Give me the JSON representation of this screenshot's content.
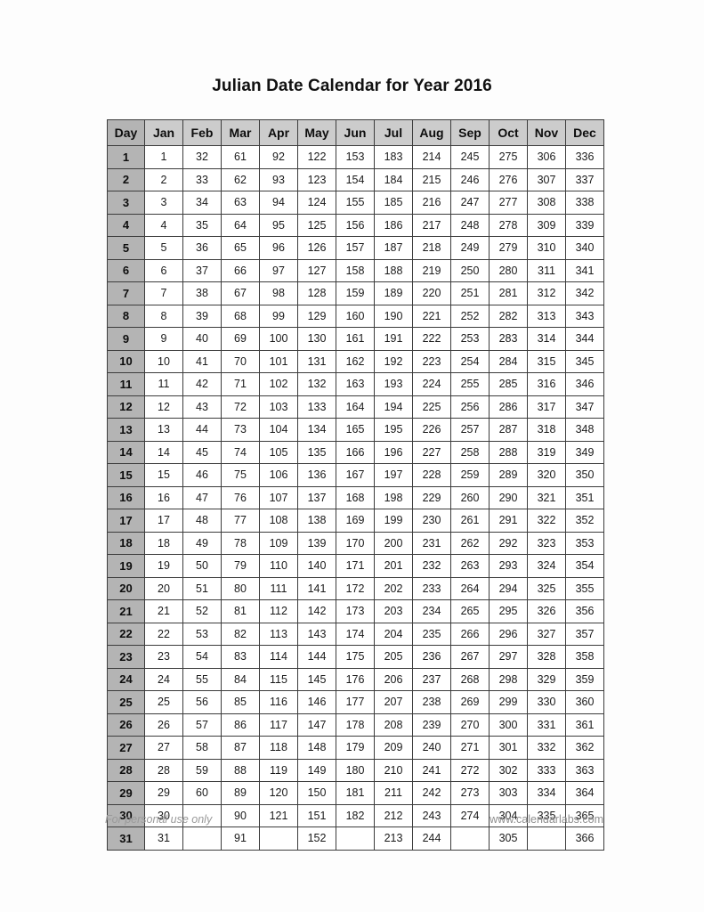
{
  "page": {
    "title": "Julian Date Calendar for Year 2016",
    "year": "2016"
  },
  "footer": {
    "left": "For personal use only",
    "right": "www.calendarlabs.com"
  },
  "colors": {
    "header_gray": "#cccccc",
    "day_column_gray": "#b4b4b4",
    "grid_line": "#3c3c3c",
    "cell_background": "#ffffff",
    "footer_text": "#9a9a9a",
    "title_text": "#111111"
  },
  "chart_data": {
    "type": "table",
    "title": "Julian Date Calendar for Year 2016",
    "columns": [
      "Day",
      "Jan",
      "Feb",
      "Mar",
      "Apr",
      "May",
      "Jun",
      "Jul",
      "Aug",
      "Sep",
      "Oct",
      "Nov",
      "Dec"
    ],
    "rows": [
      [
        "1",
        "1",
        "32",
        "61",
        "92",
        "122",
        "153",
        "183",
        "214",
        "245",
        "275",
        "306",
        "336"
      ],
      [
        "2",
        "2",
        "33",
        "62",
        "93",
        "123",
        "154",
        "184",
        "215",
        "246",
        "276",
        "307",
        "337"
      ],
      [
        "3",
        "3",
        "34",
        "63",
        "94",
        "124",
        "155",
        "185",
        "216",
        "247",
        "277",
        "308",
        "338"
      ],
      [
        "4",
        "4",
        "35",
        "64",
        "95",
        "125",
        "156",
        "186",
        "217",
        "248",
        "278",
        "309",
        "339"
      ],
      [
        "5",
        "5",
        "36",
        "65",
        "96",
        "126",
        "157",
        "187",
        "218",
        "249",
        "279",
        "310",
        "340"
      ],
      [
        "6",
        "6",
        "37",
        "66",
        "97",
        "127",
        "158",
        "188",
        "219",
        "250",
        "280",
        "311",
        "341"
      ],
      [
        "7",
        "7",
        "38",
        "67",
        "98",
        "128",
        "159",
        "189",
        "220",
        "251",
        "281",
        "312",
        "342"
      ],
      [
        "8",
        "8",
        "39",
        "68",
        "99",
        "129",
        "160",
        "190",
        "221",
        "252",
        "282",
        "313",
        "343"
      ],
      [
        "9",
        "9",
        "40",
        "69",
        "100",
        "130",
        "161",
        "191",
        "222",
        "253",
        "283",
        "314",
        "344"
      ],
      [
        "10",
        "10",
        "41",
        "70",
        "101",
        "131",
        "162",
        "192",
        "223",
        "254",
        "284",
        "315",
        "345"
      ],
      [
        "11",
        "11",
        "42",
        "71",
        "102",
        "132",
        "163",
        "193",
        "224",
        "255",
        "285",
        "316",
        "346"
      ],
      [
        "12",
        "12",
        "43",
        "72",
        "103",
        "133",
        "164",
        "194",
        "225",
        "256",
        "286",
        "317",
        "347"
      ],
      [
        "13",
        "13",
        "44",
        "73",
        "104",
        "134",
        "165",
        "195",
        "226",
        "257",
        "287",
        "318",
        "348"
      ],
      [
        "14",
        "14",
        "45",
        "74",
        "105",
        "135",
        "166",
        "196",
        "227",
        "258",
        "288",
        "319",
        "349"
      ],
      [
        "15",
        "15",
        "46",
        "75",
        "106",
        "136",
        "167",
        "197",
        "228",
        "259",
        "289",
        "320",
        "350"
      ],
      [
        "16",
        "16",
        "47",
        "76",
        "107",
        "137",
        "168",
        "198",
        "229",
        "260",
        "290",
        "321",
        "351"
      ],
      [
        "17",
        "17",
        "48",
        "77",
        "108",
        "138",
        "169",
        "199",
        "230",
        "261",
        "291",
        "322",
        "352"
      ],
      [
        "18",
        "18",
        "49",
        "78",
        "109",
        "139",
        "170",
        "200",
        "231",
        "262",
        "292",
        "323",
        "353"
      ],
      [
        "19",
        "19",
        "50",
        "79",
        "110",
        "140",
        "171",
        "201",
        "232",
        "263",
        "293",
        "324",
        "354"
      ],
      [
        "20",
        "20",
        "51",
        "80",
        "111",
        "141",
        "172",
        "202",
        "233",
        "264",
        "294",
        "325",
        "355"
      ],
      [
        "21",
        "21",
        "52",
        "81",
        "112",
        "142",
        "173",
        "203",
        "234",
        "265",
        "295",
        "326",
        "356"
      ],
      [
        "22",
        "22",
        "53",
        "82",
        "113",
        "143",
        "174",
        "204",
        "235",
        "266",
        "296",
        "327",
        "357"
      ],
      [
        "23",
        "23",
        "54",
        "83",
        "114",
        "144",
        "175",
        "205",
        "236",
        "267",
        "297",
        "328",
        "358"
      ],
      [
        "24",
        "24",
        "55",
        "84",
        "115",
        "145",
        "176",
        "206",
        "237",
        "268",
        "298",
        "329",
        "359"
      ],
      [
        "25",
        "25",
        "56",
        "85",
        "116",
        "146",
        "177",
        "207",
        "238",
        "269",
        "299",
        "330",
        "360"
      ],
      [
        "26",
        "26",
        "57",
        "86",
        "117",
        "147",
        "178",
        "208",
        "239",
        "270",
        "300",
        "331",
        "361"
      ],
      [
        "27",
        "27",
        "58",
        "87",
        "118",
        "148",
        "179",
        "209",
        "240",
        "271",
        "301",
        "332",
        "362"
      ],
      [
        "28",
        "28",
        "59",
        "88",
        "119",
        "149",
        "180",
        "210",
        "241",
        "272",
        "302",
        "333",
        "363"
      ],
      [
        "29",
        "29",
        "60",
        "89",
        "120",
        "150",
        "181",
        "211",
        "242",
        "273",
        "303",
        "334",
        "364"
      ],
      [
        "30",
        "30",
        "",
        "90",
        "121",
        "151",
        "182",
        "212",
        "243",
        "274",
        "304",
        "335",
        "365"
      ],
      [
        "31",
        "31",
        "",
        "91",
        "",
        "152",
        "",
        "213",
        "244",
        "",
        "305",
        "",
        "366"
      ]
    ]
  }
}
